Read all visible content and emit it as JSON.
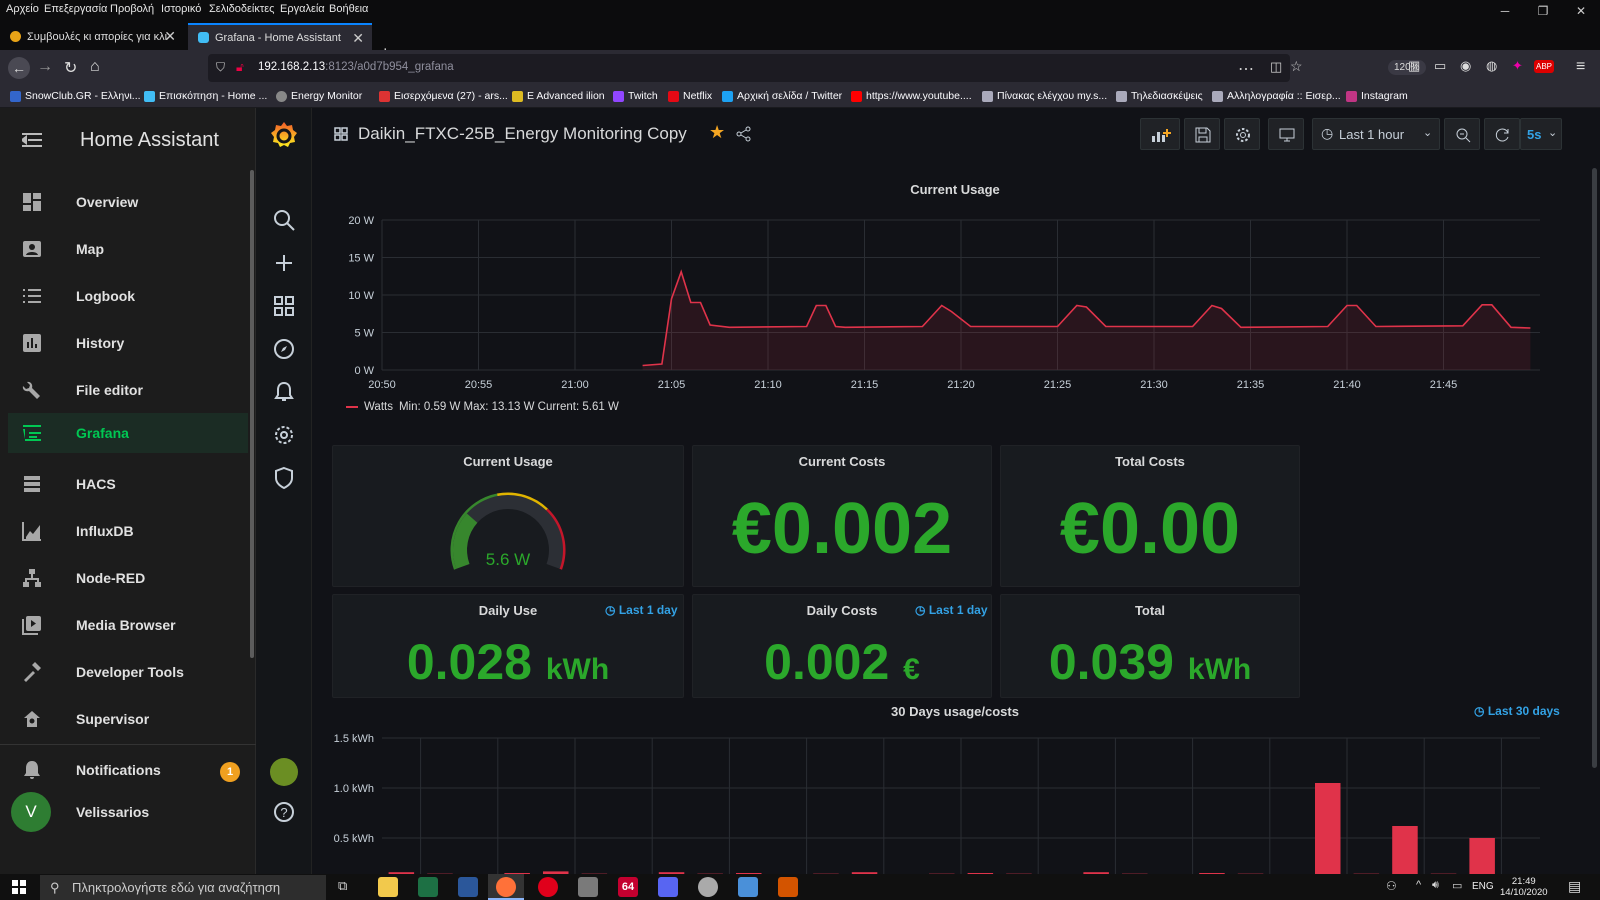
{
  "window": {
    "menu": [
      "Αρχείο",
      "Επεξεργασία",
      "Προβολή",
      "Ιστορικό",
      "Σελιδοδείκτες",
      "Εργαλεία",
      "Βοήθεια"
    ]
  },
  "tabs": [
    {
      "title": "Συμβουλές κι απορίες για κλιμ",
      "active": false
    },
    {
      "title": "Grafana - Home Assistant",
      "active": true
    }
  ],
  "address": {
    "host": "192.168.2.13",
    "path": ":8123/a0d7b954_grafana",
    "zoom": "120%"
  },
  "bookmarks": [
    "SnowClub.GR - Ελληνι...",
    "Επισκόπηση - Home ...",
    "Energy Monitor",
    "Εισερχόμενα (27) - ars...",
    "E Advanced ilion",
    "Twitch",
    "Netflix",
    "Αρχική σελίδα / Twitter",
    "https://www.youtube....",
    "Πίνακας ελέγχου my.s...",
    "Τηλεδιασκέψεις",
    "Αλληλογραφία :: Εισερ...",
    "Instagram"
  ],
  "ha": {
    "title": "Home Assistant",
    "items": [
      {
        "label": "Overview",
        "icon": "dashboard-icon"
      },
      {
        "label": "Map",
        "icon": "map-icon"
      },
      {
        "label": "Logbook",
        "icon": "logbook-icon"
      },
      {
        "label": "History",
        "icon": "history-icon"
      },
      {
        "label": "File editor",
        "icon": "wrench-icon"
      },
      {
        "label": "Grafana",
        "icon": "grafana-icon",
        "active": true
      },
      {
        "label": "HACS",
        "icon": "hacs-icon"
      },
      {
        "label": "InfluxDB",
        "icon": "chart-icon"
      },
      {
        "label": "Node-RED",
        "icon": "sitemap-icon"
      },
      {
        "label": "Media Browser",
        "icon": "media-icon"
      },
      {
        "label": "Developer Tools",
        "icon": "hammer-icon"
      },
      {
        "label": "Supervisor",
        "icon": "supervisor-icon"
      }
    ],
    "notifications": {
      "label": "Notifications",
      "count": "1"
    },
    "user": {
      "name": "Velissarios",
      "initial": "V"
    }
  },
  "grafana": {
    "dashboard_title": "Daikin_FTXC-25B_Energy Monitoring Copy",
    "time_range": "Last 1 hour",
    "refresh": "5s",
    "panels": {
      "usage_graph": {
        "title": "Current Usage",
        "legend": "Watts",
        "legend_stats": "Min: 0.59 W  Max: 13.13 W  Current: 5.61 W"
      },
      "gauge": {
        "title": "Current Usage",
        "value": "5.6 W",
        "fill": 0.28
      },
      "current_costs": {
        "title": "Current Costs",
        "value": "€0.002"
      },
      "total_costs": {
        "title": "Total Costs",
        "value": "€0.00"
      },
      "daily_use": {
        "title": "Daily Use",
        "range": "Last 1 day",
        "value": "0.028",
        "unit": "kWh"
      },
      "daily_costs": {
        "title": "Daily Costs",
        "range": "Last 1 day",
        "value": "0.002",
        "unit": "€"
      },
      "total": {
        "title": "Total",
        "value": "0.039",
        "unit": "kWh"
      },
      "days30": {
        "title": "30 Days usage/costs",
        "range": "Last 30 days"
      }
    }
  },
  "taskbar": {
    "search_placeholder": "Πληκτρολογήστε εδώ για αναζήτηση",
    "lang": "ENG",
    "time": "21:49",
    "date": "14/10/2020",
    "app_badge": "64"
  },
  "colors": {
    "ha_active": "#00c853",
    "grafana_green": "#2ba82b",
    "series_red": "#e0334a",
    "link_blue": "#33a2e5"
  },
  "chart_data": [
    {
      "type": "line",
      "title": "Current Usage",
      "xlabel": "",
      "ylabel": "",
      "x_ticks": [
        "20:50",
        "20:55",
        "21:00",
        "21:05",
        "21:10",
        "21:15",
        "21:20",
        "21:25",
        "21:30",
        "21:35",
        "21:40",
        "21:45"
      ],
      "y_ticks": [
        "0 W",
        "5 W",
        "10 W",
        "15 W",
        "20 W"
      ],
      "ylim": [
        0,
        20
      ],
      "xlim": [
        "20:50",
        "21:50"
      ],
      "series": [
        {
          "name": "Watts",
          "x": [
            "21:03.5",
            "21:04.5",
            "21:05",
            "21:05.5",
            "21:06",
            "21:06.5",
            "21:07",
            "21:08",
            "21:12",
            "21:12.5",
            "21:13",
            "21:13.5",
            "21:14",
            "21:18",
            "21:19",
            "21:19.5",
            "21:20.5",
            "21:25",
            "21:26",
            "21:26.5",
            "21:27.5",
            "21:32",
            "21:33",
            "21:33.5",
            "21:34.5",
            "21:39",
            "21:40",
            "21:40.5",
            "21:41.5",
            "21:46",
            "21:47",
            "21:47.5",
            "21:48.5",
            "21:49.5"
          ],
          "y": [
            0.6,
            0.8,
            9.5,
            13.1,
            9,
            9,
            6,
            5.7,
            5.8,
            8.6,
            8.6,
            5.8,
            5.7,
            5.8,
            8.6,
            7.8,
            5.8,
            5.8,
            8.6,
            8.4,
            5.8,
            5.8,
            8.6,
            8.2,
            5.7,
            5.8,
            8.6,
            8.6,
            5.8,
            5.9,
            8.7,
            8.7,
            5.7,
            5.6
          ]
        }
      ]
    },
    {
      "type": "bar",
      "title": "30 Days usage/costs",
      "y_ticks": [
        "0.5 kWh",
        "1.0 kWh",
        "1.5 kWh"
      ],
      "ylim": [
        0.5,
        1.5
      ],
      "series": [
        {
          "name": "",
          "values": [
            0.05,
            0.03,
            0.02,
            0.04,
            0.06,
            0.03,
            0.02,
            0.05,
            0.03,
            0.04,
            0.02,
            0.03,
            0.05,
            0.02,
            0.03,
            0.04,
            0.03,
            0.02,
            0.05,
            0.03,
            0.02,
            0.04,
            0.03,
            0.02,
            1.05,
            0.03,
            0.62,
            0.03,
            0.5,
            0.02
          ]
        }
      ]
    }
  ]
}
